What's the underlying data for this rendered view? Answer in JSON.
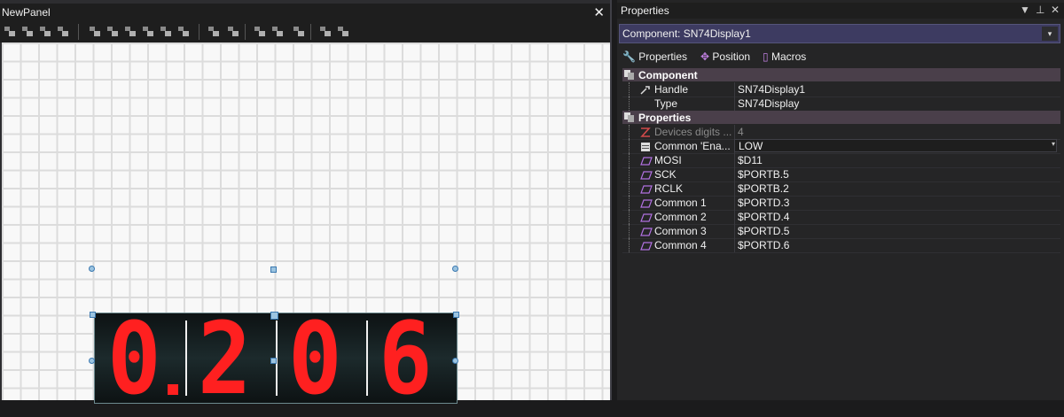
{
  "left_panel": {
    "title": "NewPanel",
    "close_glyph": "✕",
    "toolbar_icons": [
      "align-left-icon",
      "align-center-icon",
      "align-right-icon",
      "align-bottom-icon",
      "align-top-icon",
      "center-horizontal-icon",
      "center-vertical-icon",
      "align-middle-icon",
      "distribute-h-icon",
      "distribute-v-icon",
      "space-h-icon",
      "space-v-icon",
      "same-size-icon",
      "same-width-icon",
      "same-height-icon",
      "bring-front-icon",
      "send-back-icon"
    ]
  },
  "display": {
    "digits": [
      "0",
      "2",
      "0",
      "6"
    ],
    "dots": [
      true,
      false,
      false,
      false
    ],
    "segment_color": "#ff2020"
  },
  "properties_panel": {
    "title": "Properties",
    "header_icons": [
      "dropdown-icon",
      "pin-icon",
      "close-icon"
    ],
    "component_select": "Component: SN74Display1",
    "tabs": [
      {
        "label": "Properties",
        "icon": "wrench-icon"
      },
      {
        "label": "Position",
        "icon": "move-icon"
      },
      {
        "label": "Macros",
        "icon": "macros-icon"
      }
    ],
    "categories": [
      {
        "label": "Component",
        "rows": [
          {
            "name": "Handle",
            "value": "SN74Display1",
            "icon": "wrench-icon"
          },
          {
            "name": "Type",
            "value": "SN74Display",
            "icon": ""
          }
        ]
      },
      {
        "label": "Properties",
        "rows": [
          {
            "name": "Devices digits ...",
            "value": "4",
            "icon": "z-icon",
            "dim": true
          },
          {
            "name": "Common 'Ena...",
            "value": "LOW",
            "icon": "list-icon",
            "dropdown": true
          },
          {
            "name": "MOSI",
            "value": "$D11",
            "icon": "pin-io-icon"
          },
          {
            "name": "SCK",
            "value": "$PORTB.5",
            "icon": "pin-io-icon"
          },
          {
            "name": "RCLK",
            "value": "$PORTB.2",
            "icon": "pin-io-icon"
          },
          {
            "name": "Common 1",
            "value": "$PORTD.3",
            "icon": "pin-io-icon"
          },
          {
            "name": "Common 2",
            "value": "$PORTD.4",
            "icon": "pin-io-icon"
          },
          {
            "name": "Common 3",
            "value": "$PORTD.5",
            "icon": "pin-io-icon"
          },
          {
            "name": "Common 4",
            "value": "$PORTD.6",
            "icon": "pin-io-icon"
          }
        ]
      }
    ]
  }
}
